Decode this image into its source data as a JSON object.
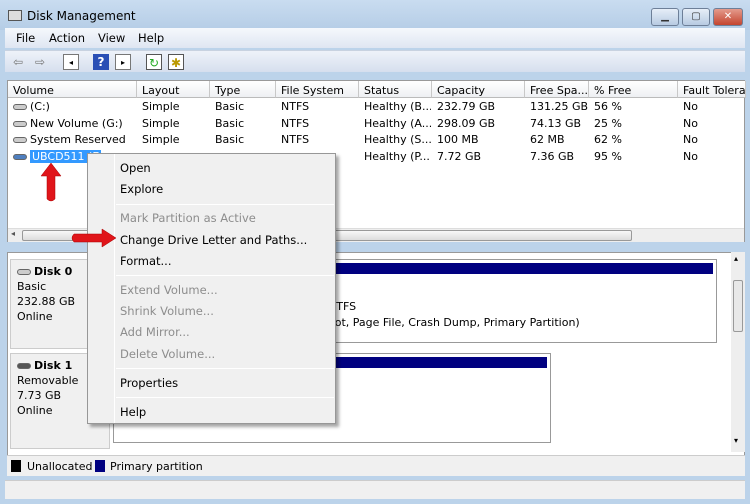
{
  "window": {
    "title": "Disk Management",
    "min": "▁",
    "max": "▢",
    "close": "✕"
  },
  "menubar": [
    "File",
    "Action",
    "View",
    "Help"
  ],
  "toolbar": [
    "back-icon",
    "forward-icon",
    "console-tree-icon",
    "help-icon",
    "action-pane-icon",
    "refresh-icon",
    "properties-icon"
  ],
  "table": {
    "columns": [
      "Volume",
      "Layout",
      "Type",
      "File System",
      "Status",
      "Capacity",
      "Free Spa...",
      "% Free",
      "Fault Tolera"
    ],
    "rows": [
      [
        "(C:)",
        "Simple",
        "Basic",
        "NTFS",
        "Healthy (B...",
        "232.79 GB",
        "131.25 GB",
        "56 %",
        "No"
      ],
      [
        "New Volume (G:)",
        "Simple",
        "Basic",
        "NTFS",
        "Healthy (A...",
        "298.09 GB",
        "74.13 GB",
        "25 %",
        "No"
      ],
      [
        "System Reserved",
        "Simple",
        "Basic",
        "NTFS",
        "Healthy (S...",
        "100 MB",
        "62 MB",
        "62 %",
        "No"
      ],
      [
        "UBCD511 (E",
        "",
        "",
        "",
        "Healthy (P...",
        "7.72 GB",
        "7.36 GB",
        "95 %",
        "No"
      ]
    ]
  },
  "disks": [
    {
      "name": "Disk 0",
      "type": "Basic",
      "size": "232.88 GB",
      "state": "Online",
      "part_fs": "NTFS",
      "part_status": "oot, Page File, Crash Dump, Primary Partition)"
    },
    {
      "name": "Disk 1",
      "type": "Removable",
      "size": "7.73 GB",
      "state": "Online"
    }
  ],
  "legend": [
    {
      "label": "Unallocated",
      "color": "#000000"
    },
    {
      "label": "Primary partition",
      "color": "#000080"
    }
  ],
  "context_menu": {
    "open": "Open",
    "explore": "Explore",
    "mark_active": "Mark Partition as Active",
    "change_letter": "Change Drive Letter and Paths...",
    "format": "Format...",
    "extend": "Extend Volume...",
    "shrink": "Shrink Volume...",
    "add_mirror": "Add Mirror...",
    "delete": "Delete Volume...",
    "properties": "Properties",
    "help": "Help"
  },
  "colors": {
    "selection": "#3399ff",
    "partition_header": "#000080",
    "annotation_arrow": "#e0151a"
  }
}
